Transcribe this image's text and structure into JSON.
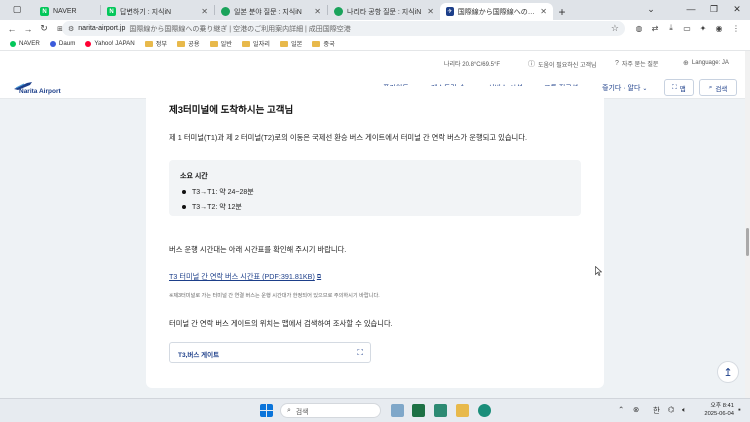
{
  "browser": {
    "tabs": [
      {
        "label": "NAVER",
        "color": "#03c75a",
        "glyph": "N"
      },
      {
        "label": "답변하기 : 지식iN",
        "color": "#03c75a",
        "glyph": "N"
      },
      {
        "label": "일본 분야 질문 : 지식iN",
        "color": "#1aa35b",
        "glyph": "●"
      },
      {
        "label": "나리타 공항 질문 : 지식iN",
        "color": "#1aa35b",
        "glyph": "●"
      },
      {
        "label": "国際線から国際線への乗り継",
        "color": "#1d3f8a",
        "glyph": "✈"
      }
    ],
    "new_tab": "+",
    "address": {
      "domain": "narita-airport.jp",
      "title": "国際線から国際線への乗り継ぎ | 空港のご利用案内詳細 | 成田国際空港"
    },
    "bookmarks": [
      {
        "label": "NAVER",
        "type": "site",
        "color": "#03c75a"
      },
      {
        "label": "Daum",
        "type": "site",
        "color": "#3b5bdb"
      },
      {
        "label": "Yahoo! JAPAN",
        "type": "site",
        "color": "#ff0033"
      },
      {
        "label": "정부",
        "type": "folder"
      },
      {
        "label": "공용",
        "type": "folder"
      },
      {
        "label": "일반",
        "type": "folder"
      },
      {
        "label": "일자리",
        "type": "folder"
      },
      {
        "label": "일본",
        "type": "folder"
      },
      {
        "label": "중국",
        "type": "folder"
      }
    ]
  },
  "site": {
    "util": {
      "weather": "나리타 20.8°C/69.5°F",
      "help": "도움이 필요하신 고객님",
      "faq": "자주 묻는 질문",
      "language": "Language: JA"
    },
    "logo_text": "Narita Airport",
    "nav": [
      "플라이트",
      "레스토랑·숍",
      "서비스·시설",
      "교통 접근성",
      "즐기다 · 알다"
    ],
    "map_button": "맵",
    "search_button": "검색"
  },
  "content": {
    "heading": "제3터미널에 도착하시는 고객님",
    "intro": "제 1 터미널(T1)과 제 2 터미널(T2)로의 이동은 국제선 환승 버스 게이트에서 터미널 간 연락 버스가 운행되고 있습니다.",
    "duration_title": "소요 시간",
    "durations": [
      "T3→T1: 약 24~28분",
      "T3→T2: 약 12분"
    ],
    "schedule_text": "버스 운행 시간대는 아래 시간표를 확인해 주시기 바랍니다.",
    "pdf_link": "T3 터미널 간 연락 버스 시간표 (PDF:391.81KB)",
    "note": "※제3터미널로 가는 터미널 간 연결 버스는 운행 시간대가 한정되어 있으므로 주의하시기 바랍니다.",
    "map_text": "터미널 간 연락 버스 게이트의 위치는 맵에서 검색하여 조사할 수 있습니다.",
    "map_item": "T3,버스 게이트"
  },
  "taskbar": {
    "search_placeholder": "검색",
    "ime": "한",
    "time": "오후 8:41",
    "date": "2025-06-04"
  }
}
